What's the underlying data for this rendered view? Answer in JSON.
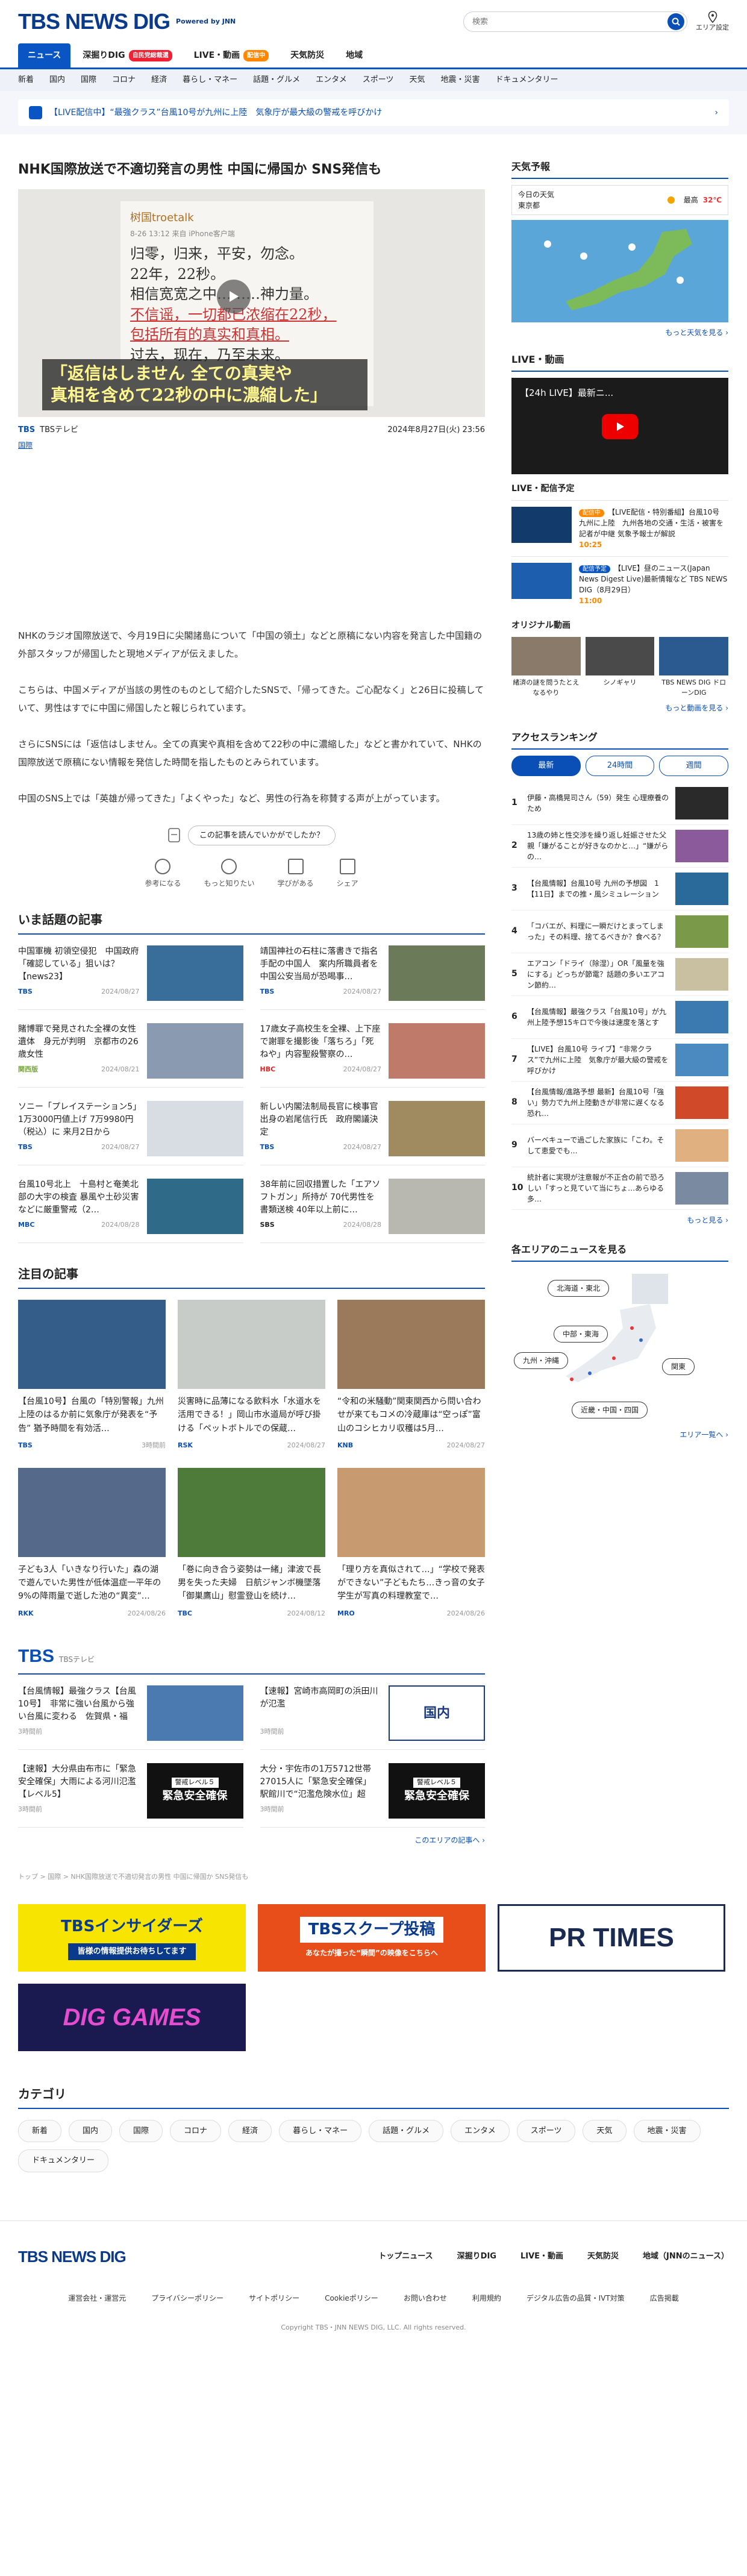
{
  "header": {
    "logo": "TBS NEWS DIG",
    "powered": "Powered by JNN",
    "search_placeholder": "検索",
    "area_setting": "エリア設定"
  },
  "nav": [
    {
      "label": "ニュース",
      "active": true
    },
    {
      "label": "深掘りDIG",
      "badge": "自民党総裁選"
    },
    {
      "label": "LIVE・動画",
      "badge": "配信中"
    },
    {
      "label": "天気防災"
    },
    {
      "label": "地域"
    }
  ],
  "subnav": [
    "新着",
    "国内",
    "国際",
    "コロナ",
    "経済",
    "暮らし・マネー",
    "話題・グルメ",
    "エンタメ",
    "スポーツ",
    "天気",
    "地震・災害",
    "ドキュメンタリー"
  ],
  "ticker": "【LIVE配信中】“最強クラス”台風10号が九州に上陸　気象庁が最大級の警戒を呼びかけ",
  "article": {
    "title": "NHK国際放送で不適切発言の男性 中国に帰国か SNS発信も",
    "image": {
      "user": "树国troetalk",
      "meta": "8-26 13:12 来自 iPhone客户端",
      "lines": [
        "归零，归来，平安，勿念。",
        "22年，22秒。",
        "相信宽宽之中………神力量。",
        "不信谣，一切都已浓缩在22秒，",
        "包括所有的真实和真相。",
        "过去，现在，乃至未来。"
      ],
      "caption1": "「返信はしません 全ての真実や",
      "caption2": "真相を含めて22秒の中に濃縮した」"
    },
    "source": "TBSテレビ",
    "datetime": "2024年8月27日(火) 23:56",
    "category": "国際",
    "paragraphs": [
      "NHKのラジオ国際放送で、今月19日に尖閣諸島について「中国の領土」などと原稿にない内容を発言した中国籍の外部スタッフが帰国したと現地メディアが伝えました。",
      "こちらは、中国メディアが当該の男性のものとして紹介したSNSで、「帰ってきた。ご心配なく」と26日に投稿していて、男性はすでに中国に帰国したと報じられています。",
      "さらにSNSには「返信はしません。全ての真実や真相を含めて22秒の中に濃縮した」などと書かれていて、NHKの国際放送で原稿にない情報を発信した時間を指したものとみられています。",
      "中国のSNS上では「英雄が帰ってきた」「よくやった」など、男性の行為を称賛する声が上がっています。"
    ],
    "rate_question": "この記事を読んでいかがでしたか？",
    "rate_buttons": [
      "参考になる",
      "もっと知りたい",
      "学びがある",
      "シェア"
    ]
  },
  "hot": {
    "title": "いま話題の記事",
    "items": [
      {
        "text": "中国軍機 初領空侵犯　中国政府「確認している」狙いは？【news23】",
        "source": "TBS",
        "date": "2024/08/27",
        "color": "#3a6e9a"
      },
      {
        "text": "靖国神社の石柱に落書きで指名手配の中国人　案内所職員者を中国公安当局が恐喝事…",
        "source": "TBS",
        "date": "2024/08/27",
        "color": "#6b7b5a"
      },
      {
        "text": "賭博罪で発見された全裸の女性遺体　身元が判明　京都市の26歳女性",
        "source": "関西版",
        "date": "2024/08/21",
        "color": "#8a9ab0"
      },
      {
        "text": "17歳女子高校生を全裸、上下座で謝罪を撮影後「落ちろ」「死ねや」内容聖殺警察の…",
        "source": "HBC",
        "date": "2024/08/27",
        "color": "#c07a6a"
      },
      {
        "text": "ソニー「プレイステーション5」1万3000円値上げ 7万9980円（税込）に 来月2日から",
        "source": "TBS",
        "date": "2024/08/27",
        "color": "#d8dde4"
      },
      {
        "text": "新しい内閣法制局長官に検事官出身の岩尾信行氏　政府閣議決定",
        "source": "TBS",
        "date": "2024/08/27",
        "color": "#a08a60"
      },
      {
        "text": "台風10号北上　十島村と奄美北部の大宇の検査 暴風や土砂災害などに厳重警戒（2…",
        "source": "MBC",
        "date": "2024/08/28",
        "color": "#2f6a88"
      },
      {
        "text": "38年前に回収措置した「エアソフトガン」所持が 70代男性を書類送検 40年以上前に…",
        "source": "SBS",
        "date": "2024/08/28",
        "color": "#b8b8b0"
      }
    ]
  },
  "featured": {
    "title": "注目の記事",
    "items": [
      {
        "text": "【台風10号】台風の「特別警報」九州上陸のはるか前に気象庁が発表を“予告” 猶予時間を有効活…",
        "source": "TBS",
        "date": "3時間前",
        "color": "#355d8a"
      },
      {
        "text": "災害時に品薄になる飲料水「水道水を活用できる！」岡山市水道局が呼び掛ける「ペットボトルでの保蔵…",
        "source": "RSK",
        "date": "2024/08/27",
        "color": "#c8ccc8"
      },
      {
        "text": "“令和の米騒動”関東関西から問い合わせが来てもコメの冷蔵庫は“空っぽ”富山のコシヒカリ収穫は5月…",
        "source": "KNB",
        "date": "2024/08/27",
        "color": "#9a7a5a"
      },
      {
        "text": "子ども3人「いきなり行いた」森の湖で遊んでいた男性が低体温症一平年の9%の降雨量で逝した池の“異変”…",
        "source": "RKK",
        "date": "2024/08/26",
        "color": "#556a8a"
      },
      {
        "text": "「巻に向き合う姿勢は一緒」津波で長男を失った夫婦　日航ジャンボ機墜落「御巣鷹山」慰霊登山を続け…",
        "source": "TBC",
        "date": "2024/08/12",
        "color": "#4e7a3a"
      },
      {
        "text": "「理り方を真似されて…」“学校で発表ができない”子どもたち…きっ音の女子学生が写真の料理教室で…",
        "source": "MRO",
        "date": "2024/08/26",
        "color": "#c89a70"
      }
    ]
  },
  "tbs": {
    "name": "TBS",
    "station": "TBSテレビ",
    "items": [
      {
        "text": "【台風情報】最強クラス【台風10号】　非常に強い台風から強い台風に変わる　佐賀県・福岡…",
        "date": "3時間前",
        "color": "#4a7ab0"
      },
      {
        "text": "【速報】宮崎市高岡町の浜田川が氾濫",
        "date": "3時間前",
        "color": "#ffffff",
        "label": "国内"
      },
      {
        "text": "【速報】大分県由布市に「緊急安全確保」大雨による河川氾濫【レベル5】",
        "date": "3時間前",
        "color": "#111111",
        "label": "緊急安全確保"
      },
      {
        "text": "大分・宇佐市の1万5712世帯27015人に「緊急安全確保」 駅館川で“氾濫危険水位」超え…",
        "date": "3時間前",
        "color": "#111111",
        "label": "緊急安全確保"
      }
    ],
    "level_label": "警戒レベル５",
    "more": "このエリアの記事へ ›"
  },
  "breadcrumb": "トップ > 国際 > NHK国際放送で不適切発言の男性 中国に帰国か SNS発信も",
  "banners": [
    {
      "label": "TBSインサイダーズ",
      "sub": "皆様の情報提供お待ちしてます",
      "color": "#f7e400"
    },
    {
      "label": "TBSスクープ投稿",
      "sub": "あなたが撮った“瞬間”の映像をこちらへ",
      "color": "#e84e1a"
    },
    {
      "label": "PR TIMES",
      "sub": "",
      "color": "#ffffff"
    },
    {
      "label": "DIG GAMES",
      "sub": "",
      "color": "#1a1a50"
    }
  ],
  "category": {
    "title": "カテゴリ",
    "items": [
      "新着",
      "国内",
      "国際",
      "コロナ",
      "経済",
      "暮らし・マネー",
      "話題・グルメ",
      "エンタメ",
      "スポーツ",
      "天気",
      "地震・災害",
      "ドキュメンタリー"
    ]
  },
  "side": {
    "weather_title": "天気予報",
    "weather_today": "今日の天気",
    "weather_area": "東京都",
    "weather_max_label": "最高",
    "weather_max": "32℃",
    "weather_more": "もっと天気を見る ›",
    "live_title": "LIVE・動画",
    "live_video": "【24h LIVE】最新ニ...",
    "schedule_title": "LIVE・配信予定",
    "schedule": [
      {
        "status": "配信中",
        "text": "【LIVE配信・特別番組】台風10号 九州に上陸　九州各地の交通・生活・被害を記者が中継 気象予報士が解説",
        "time": "10:25",
        "color": "#123a6a"
      },
      {
        "status": "配信予定",
        "text": "【LIVE】昼のニュース(Japan News Digest Live)最新情報など TBS NEWS DIG（8月29日）",
        "time": "11:00",
        "color": "#1d5fae"
      }
    ],
    "original_title": "オリジナル動画",
    "originals": [
      "緒済の謎を問うたとえなるやり",
      "シノギャリ",
      "TBS NEWS DIG ドローンDIG"
    ],
    "video_more": "もっと動画を見る ›",
    "ranking_title": "アクセスランキング",
    "ranking_tabs": [
      "最新",
      "24時間",
      "週間"
    ],
    "ranking": [
      {
        "no": "1",
        "text": "伊藤・高橋晃司さん（59）発生 心理療養のため",
        "color": "#2a2a2a"
      },
      {
        "no": "2",
        "text": "13歳の姉と性交渉を繰り返し妊娠させた父親「嫌がることが好きなのかと…」“嫌がらの…",
        "color": "#8a5a9a"
      },
      {
        "no": "3",
        "text": "【台風情報】台風10号 九州の予想図　1【11日】までの推・風シミュレーション",
        "color": "#2a6a9a"
      },
      {
        "no": "4",
        "text": "「コバエが、料理に一瞬だけとまってしまった」その料理、捨てるべきか？食べる？",
        "color": "#7a9a4a"
      },
      {
        "no": "5",
        "text": "エアコン「ドライ（除湿）」OR「風量を強にする」どっちが節電？話題の多いエアコン節約…",
        "color": "#c8c0a0"
      },
      {
        "no": "6",
        "text": "【台風情報】最強クラス「台風10号」が九州上陸予想15キロで今後は速度を落とす",
        "color": "#3a7ab0"
      },
      {
        "no": "7",
        "text": "【LIVE】台風10号 ライブ】“非常クラス”で九州に上陸　気象庁が最大級の警戒を呼びかけ",
        "color": "#4a8ac0"
      },
      {
        "no": "8",
        "text": "【台風情報/進路予想 最新】台風10号「強い」勢力で九州上陸動きが非常に遅くなる恐れ…",
        "color": "#d04a2a"
      },
      {
        "no": "9",
        "text": "バーベキューで過ごした家族に「こわ。そして恵愛でも…",
        "color": "#e0b080"
      },
      {
        "no": "10",
        "text": "統計者に実現が注意報が不正合の前で恐ろしい「すっと見ていて当にちょ…あらゆる多…",
        "color": "#7a8aa0"
      }
    ],
    "ranking_more": "もっと見る ›",
    "area_title": "各エリアのニュースを見る",
    "areas": [
      "北海道・東北",
      "中部・東海",
      "九州・沖縄",
      "関東",
      "近畿・中国・四国"
    ],
    "area_more": "エリア一覧へ ›"
  },
  "footer": {
    "logo": "TBS NEWS DIG",
    "links1": [
      "トップニュース",
      "深掘りDIG",
      "LIVE・動画",
      "天気防災",
      "地域（JNNのニュース）"
    ],
    "links2": [
      "運営会社・運営元",
      "プライバシーポリシー",
      "サイトポリシー",
      "Cookieポリシー",
      "お問い合わせ",
      "利用規約",
      "デジタル広告の品質・IVT対策",
      "広告掲載"
    ],
    "copyright": "Copyright TBS・JNN NEWS DIG, LLC. All rights reserved."
  }
}
